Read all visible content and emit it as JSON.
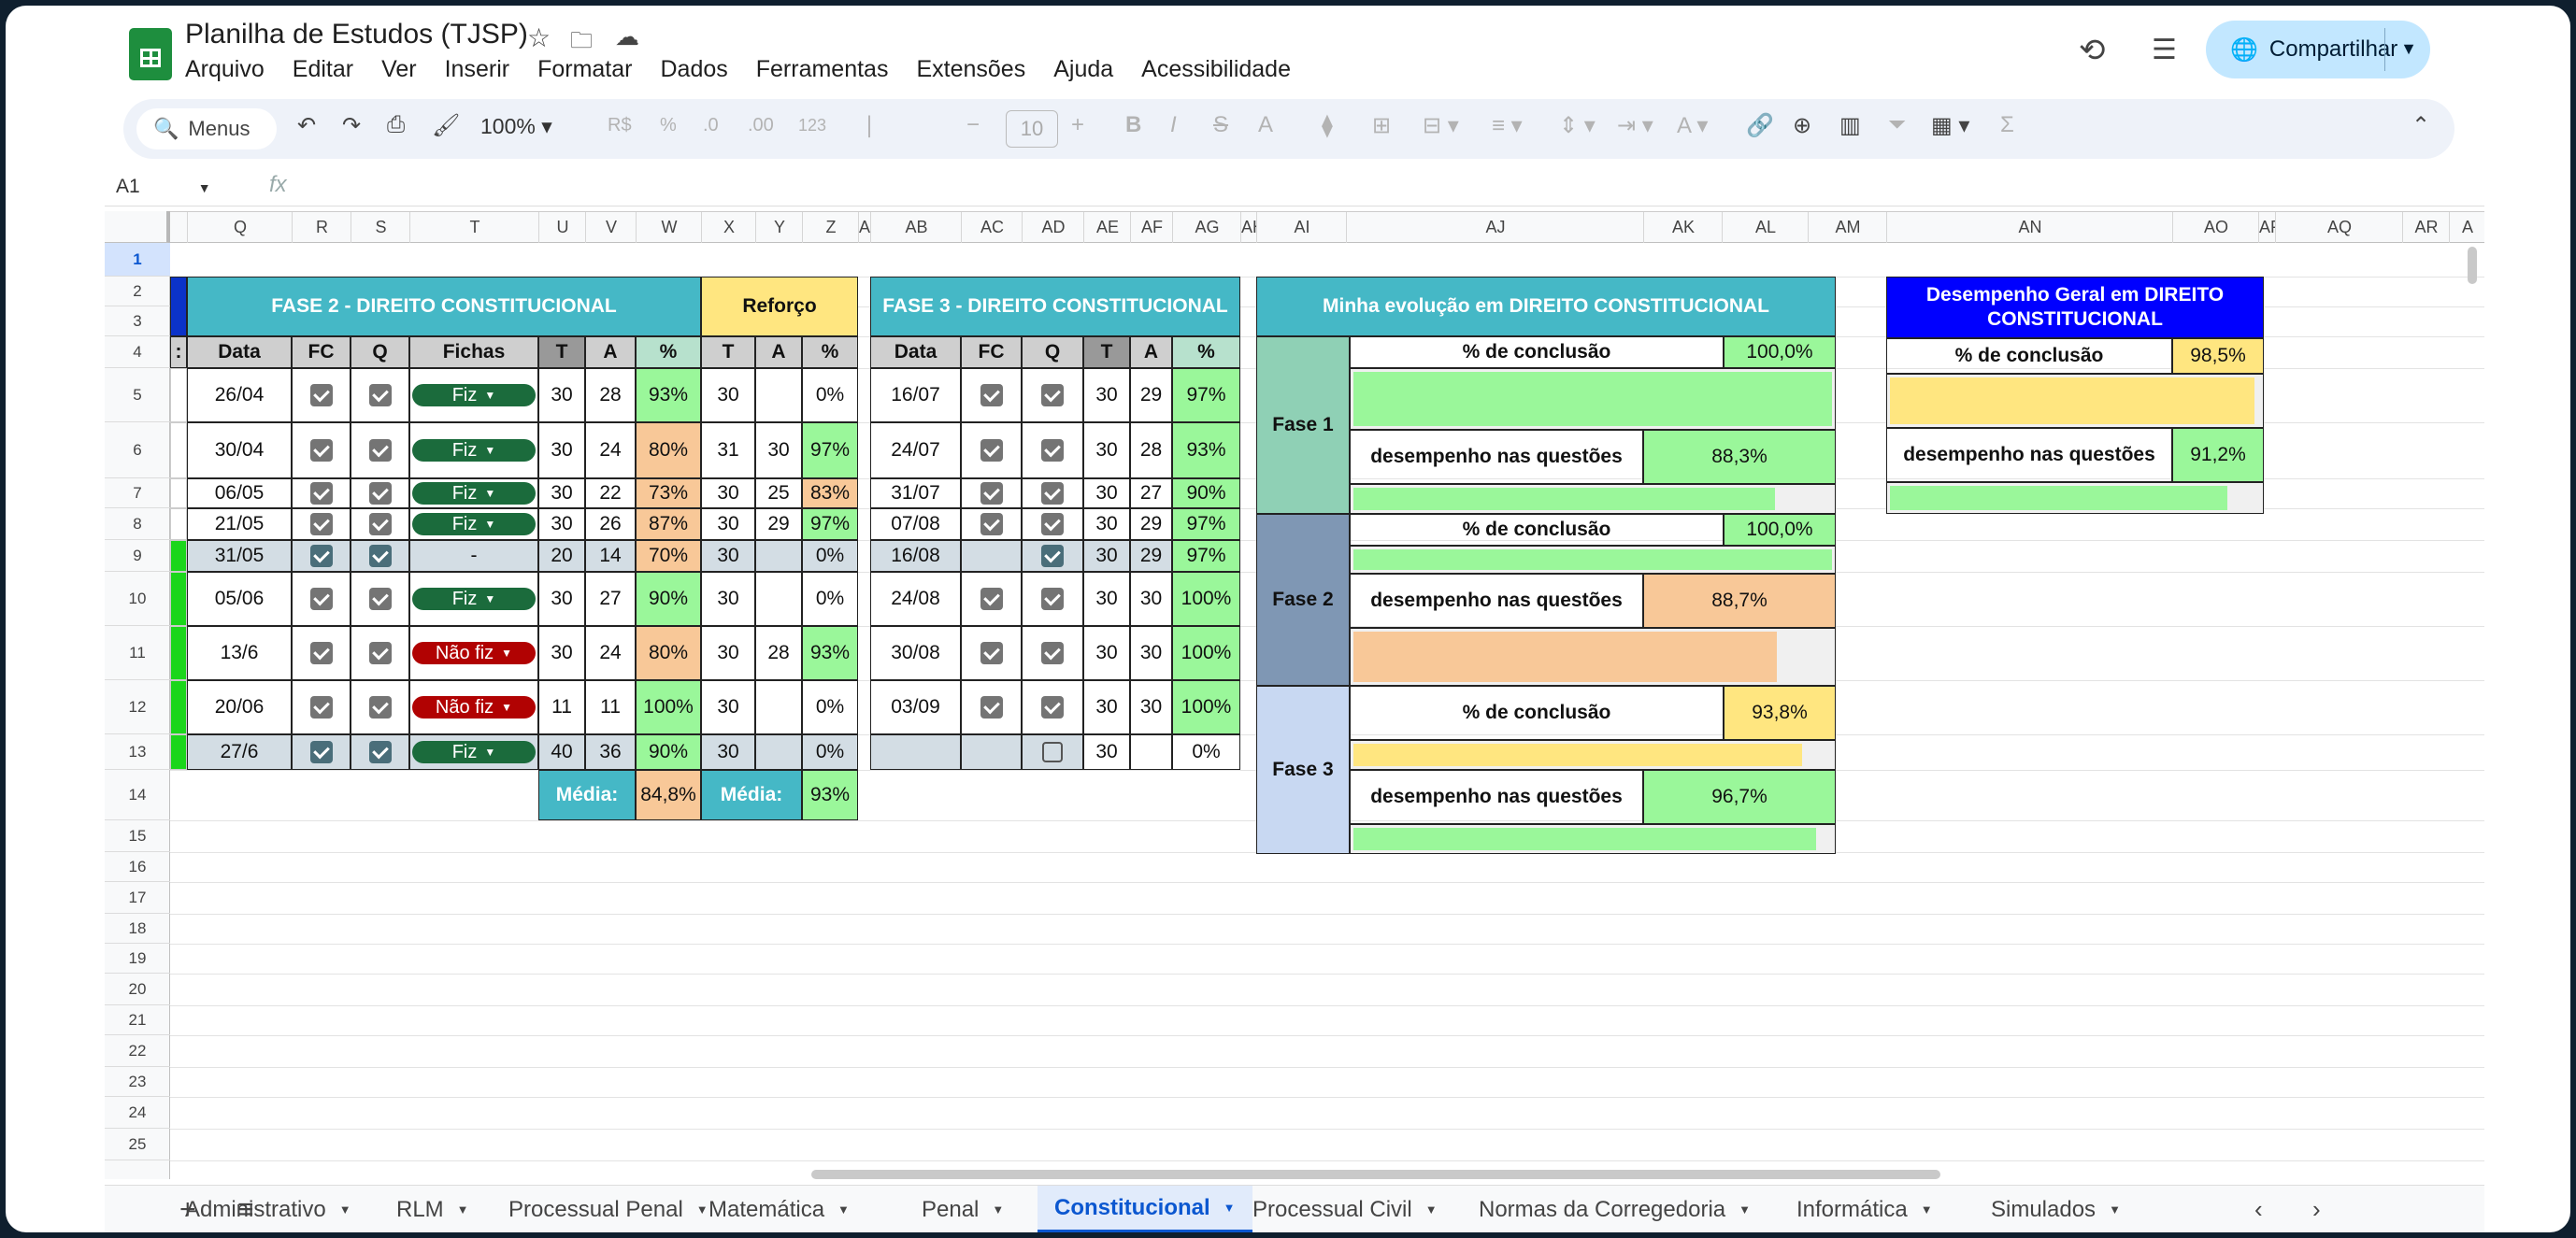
{
  "app": {
    "title": "Planilha de Estudos (TJSP)",
    "menus": [
      "Arquivo",
      "Editar",
      "Ver",
      "Inserir",
      "Formatar",
      "Dados",
      "Ferramentas",
      "Extensões",
      "Ajuda",
      "Acessibilidade"
    ],
    "share_label": "Compartilhar"
  },
  "toolbar": {
    "search_placeholder": "Menus",
    "zoom": "100%",
    "currency": "R$",
    "percent": "%",
    "dec_less": ".0",
    "dec_more": ".00",
    "number_format": "123",
    "font_size": "10"
  },
  "formula_bar": {
    "name_box": "A1",
    "fx": "fx"
  },
  "columns": [
    "Q",
    "R",
    "S",
    "T",
    "U",
    "V",
    "W",
    "X",
    "Y",
    "Z",
    "AA",
    "AB",
    "AC",
    "AD",
    "AE",
    "AF",
    "AG",
    "AH",
    "AI",
    "AJ",
    "AK",
    "AL",
    "AM",
    "AN",
    "AO",
    "AP",
    "AQ",
    "AR",
    "A"
  ],
  "rows": [
    "1",
    "2",
    "3",
    "4",
    "5",
    "6",
    "7",
    "8",
    "9",
    "10",
    "11",
    "12",
    "13",
    "14",
    "15",
    "16",
    "17",
    "18",
    "19",
    "20",
    "21",
    "22",
    "23",
    "24",
    "25"
  ],
  "fase2": {
    "title": "FASE 2 - DIREITO CONSTITUCIONAL",
    "headers": [
      "Data",
      "FC",
      "Q",
      "Fichas",
      "T",
      "A",
      "%"
    ],
    "rows": [
      {
        "data": "26/04",
        "ficha": "Fiz",
        "t": "30",
        "a": "28",
        "p": "93%"
      },
      {
        "data": "30/04",
        "ficha": "Fiz",
        "t": "30",
        "a": "24",
        "p": "80%"
      },
      {
        "data": "06/05",
        "ficha": "Fiz",
        "t": "30",
        "a": "22",
        "p": "73%"
      },
      {
        "data": "21/05",
        "ficha": "Fiz",
        "t": "30",
        "a": "26",
        "p": "87%"
      },
      {
        "data": "31/05",
        "ficha": "-",
        "t": "20",
        "a": "14",
        "p": "70%"
      },
      {
        "data": "05/06",
        "ficha": "Fiz",
        "t": "30",
        "a": "27",
        "p": "90%"
      },
      {
        "data": "13/6",
        "ficha": "Não fiz",
        "t": "30",
        "a": "24",
        "p": "80%"
      },
      {
        "data": "20/06",
        "ficha": "Não fiz",
        "t": "11",
        "a": "11",
        "p": "100%"
      },
      {
        "data": "27/6",
        "ficha": "Fiz",
        "t": "40",
        "a": "36",
        "p": "90%"
      }
    ],
    "media_label": "Média:",
    "media_value": "84,8%"
  },
  "reforco": {
    "title": "Reforço",
    "headers": [
      "T",
      "A",
      "%"
    ],
    "rows": [
      {
        "t": "30",
        "a": "",
        "p": "0%"
      },
      {
        "t": "31",
        "a": "30",
        "p": "97%"
      },
      {
        "t": "30",
        "a": "25",
        "p": "83%"
      },
      {
        "t": "30",
        "a": "29",
        "p": "97%"
      },
      {
        "t": "30",
        "a": "",
        "p": "0%"
      },
      {
        "t": "30",
        "a": "",
        "p": "0%"
      },
      {
        "t": "30",
        "a": "28",
        "p": "93%"
      },
      {
        "t": "30",
        "a": "",
        "p": "0%"
      },
      {
        "t": "30",
        "a": "",
        "p": "0%"
      }
    ],
    "media_label": "Média:",
    "media_value": "93%"
  },
  "fase3": {
    "title": "FASE 3 - DIREITO CONSTITUCIONAL",
    "headers": [
      "Data",
      "FC",
      "Q",
      "T",
      "A",
      "%"
    ],
    "rows": [
      {
        "data": "16/07",
        "t": "30",
        "a": "29",
        "p": "97%"
      },
      {
        "data": "24/07",
        "t": "30",
        "a": "28",
        "p": "93%"
      },
      {
        "data": "31/07",
        "t": "30",
        "a": "27",
        "p": "90%"
      },
      {
        "data": "07/08",
        "t": "30",
        "a": "29",
        "p": "97%"
      },
      {
        "data": "16/08",
        "t": "30",
        "a": "29",
        "p": "97%"
      },
      {
        "data": "24/08",
        "t": "30",
        "a": "30",
        "p": "100%"
      },
      {
        "data": "30/08",
        "t": "30",
        "a": "30",
        "p": "100%"
      },
      {
        "data": "03/09",
        "t": "30",
        "a": "30",
        "p": "100%"
      },
      {
        "data": "",
        "t": "30",
        "a": "",
        "p": "0%"
      }
    ]
  },
  "evolucao": {
    "title": "Minha evolução em DIREITO CONSTITUCIONAL",
    "conclusao_label": "% de conclusão",
    "desempenho_label": "desempenho nas questões",
    "fases": [
      {
        "name": "Fase 1",
        "conclusao": "100,0%",
        "conclusao_fill": 1.0,
        "desempenho": "88,3%",
        "desempenho_fill": 0.883
      },
      {
        "name": "Fase 2",
        "conclusao": "100,0%",
        "conclusao_fill": 1.0,
        "desempenho": "88,7%",
        "desempenho_fill": 0.887
      },
      {
        "name": "Fase 3",
        "conclusao": "93,8%",
        "conclusao_fill": 0.938,
        "desempenho": "96,7%",
        "desempenho_fill": 0.967
      }
    ]
  },
  "geral": {
    "title": "Desempenho Geral em DIREITO CONSTITUCIONAL",
    "conclusao_label": "% de conclusão",
    "conclusao": "98,5%",
    "conclusao_fill": 0.985,
    "desempenho_label": "desempenho nas questões",
    "desempenho": "91,2%",
    "desempenho_fill": 0.912
  },
  "sheets": [
    "Administrativo",
    "RLM",
    "Processual Penal",
    "Matemática",
    "Penal",
    "Constitucional",
    "Processual Civil",
    "Normas da Corregedoria",
    "Informática",
    "Simulados"
  ],
  "active_sheet": "Constitucional",
  "colors": {
    "teal": "#45b8c6",
    "green": "#9af79a",
    "orange": "#f8c898",
    "yellow": "#ffe680",
    "blue": "#0000ff",
    "chip_green": "#1b6b3c",
    "chip_red": "#b10202"
  }
}
